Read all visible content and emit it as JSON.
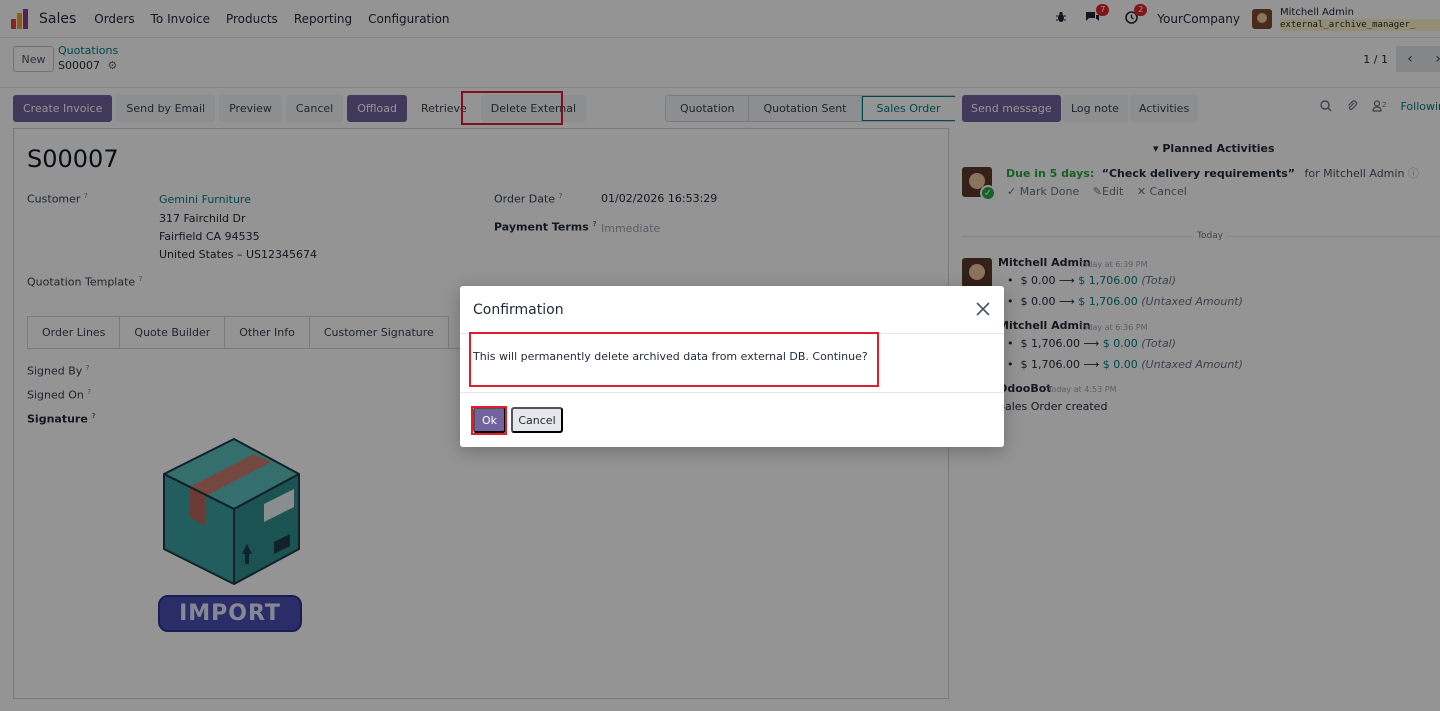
{
  "navbar": {
    "app_name": "Sales",
    "items": [
      "Orders",
      "To Invoice",
      "Products",
      "Reporting",
      "Configuration"
    ],
    "messages_badge": "7",
    "activities_badge": "2",
    "company": "YourCompany",
    "user_name": "Mitchell Admin",
    "user_db": "external_archive_manager_",
    "bug_icon": "bug-icon",
    "chat_icon": "chat-icon",
    "clock_icon": "clock-icon"
  },
  "control_panel": {
    "new_label": "New",
    "breadcrumb": "Quotations",
    "record_name": "S00007",
    "pager": "1 / 1",
    "prev_glyph": "‹",
    "next_glyph": "›"
  },
  "actions": {
    "create_invoice": "Create Invoice",
    "send_email": "Send by Email",
    "preview": "Preview",
    "cancel": "Cancel",
    "offload": "Offload",
    "retrieve": "Retrieve",
    "delete_external": "Delete External"
  },
  "status_stages": [
    "Quotation",
    "Quotation Sent",
    "Sales Order"
  ],
  "form": {
    "title": "S00007",
    "customer_label": "Customer",
    "customer_name": "Gemini Furniture",
    "address_1": "317 Fairchild Dr",
    "address_2": "Fairfield CA 94535",
    "address_3": "United States – US12345674",
    "order_date_label": "Order Date",
    "order_date": "01/02/2026 16:53:29",
    "payment_terms_label": "Payment Terms",
    "payment_terms": "Immediate",
    "template_label": "Quotation Template",
    "help_mark": "?",
    "tabs": [
      "Order Lines",
      "Quote Builder",
      "Other Info",
      "Customer Signature"
    ],
    "signed_by_label": "Signed By",
    "signed_on_label": "Signed On",
    "signature_label": "Signature",
    "import_text": "IMPORT"
  },
  "chatter": {
    "send_message": "Send message",
    "log_note": "Log note",
    "activities": "Activities",
    "followers_count": "2",
    "following": "Following",
    "planned_header": "Planned Activities",
    "due_text": "Due in 5 days:",
    "activity_title": "“Check delivery requirements”",
    "activity_for": "for Mitchell Admin",
    "mark_done": "Mark Done",
    "edit": "Edit",
    "cancel": "Cancel",
    "today": "Today",
    "messages": [
      {
        "author": "Mitchell Admin",
        "time": "Today at 6:39 PM",
        "lines": [
          {
            "old": "$ 0.00",
            "new": "$ 1,706.00",
            "field": "(Total)"
          },
          {
            "old": "$ 0.00",
            "new": "$ 1,706.00",
            "field": "(Untaxed Amount)"
          }
        ]
      },
      {
        "author": "Mitchell Admin",
        "time": "Today at 6:36 PM",
        "lines": [
          {
            "old": "$ 1,706.00",
            "new": "$ 0.00",
            "field": "(Total)"
          },
          {
            "old": "$ 1,706.00",
            "new": "$ 0.00",
            "field": "(Untaxed Amount)"
          }
        ]
      },
      {
        "author": "OdooBot",
        "time": "Today at 4:53 PM",
        "body": "Sales Order created"
      }
    ]
  },
  "dialog": {
    "title": "Confirmation",
    "message": "This will permanently delete archived data from external DB. Continue?",
    "ok": "Ok",
    "cancel": "Cancel"
  },
  "colors": {
    "primary": "#71639e",
    "link": "#017e84",
    "highlight": "#e11d2e"
  }
}
